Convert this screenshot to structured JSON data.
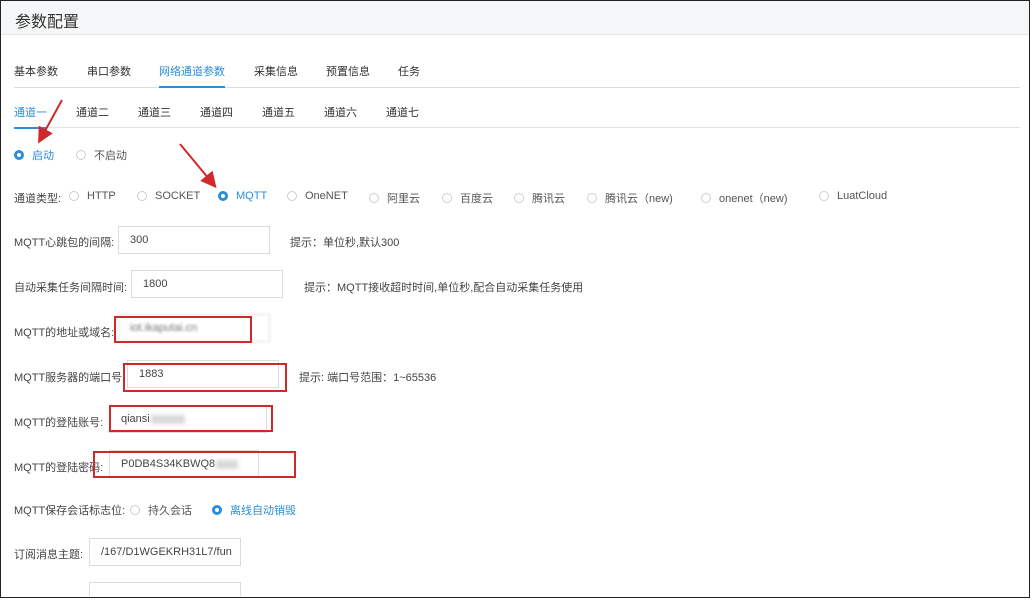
{
  "page": {
    "title": "参数配置"
  },
  "main_tabs": [
    {
      "label": "基本参数",
      "active": false
    },
    {
      "label": "串口参数",
      "active": false
    },
    {
      "label": "网络通道参数",
      "active": true
    },
    {
      "label": "采集信息",
      "active": false
    },
    {
      "label": "预置信息",
      "active": false
    },
    {
      "label": "任务",
      "active": false
    }
  ],
  "channel_tabs": [
    {
      "label": "通道一",
      "active": true
    },
    {
      "label": "通道二",
      "active": false
    },
    {
      "label": "通道三",
      "active": false
    },
    {
      "label": "通道四",
      "active": false
    },
    {
      "label": "通道五",
      "active": false
    },
    {
      "label": "通道六",
      "active": false
    },
    {
      "label": "通道七",
      "active": false
    }
  ],
  "enable": {
    "options": [
      {
        "label": "启动",
        "checked": true
      },
      {
        "label": "不启动",
        "checked": false
      }
    ]
  },
  "channel_type": {
    "label": "通道类型:",
    "options": [
      {
        "label": "HTTP",
        "checked": false
      },
      {
        "label": "SOCKET",
        "checked": false
      },
      {
        "label": "MQTT",
        "checked": true
      },
      {
        "label": "OneNET",
        "checked": false
      },
      {
        "label": "阿里云",
        "checked": false
      },
      {
        "label": "百度云",
        "checked": false
      },
      {
        "label": "腾讯云",
        "checked": false
      },
      {
        "label": "腾讯云（new)",
        "checked": false
      },
      {
        "label": "onenet（new)",
        "checked": false
      },
      {
        "label": "LuatCloud",
        "checked": false
      }
    ]
  },
  "fields": {
    "heartbeat": {
      "label": "MQTT心跳包的间隔:",
      "value": "300",
      "hint": "提示：单位秒,默认300"
    },
    "auto_collect": {
      "label": "自动采集任务间隔时间:",
      "value": "1800",
      "hint": "提示：MQTT接收超时时间,单位秒,配合自动采集任务使用"
    },
    "address": {
      "label": "MQTT的地址或域名:",
      "value": "iot.ikaputai.cn"
    },
    "port": {
      "label": "MQTT服务器的端口号:",
      "value": "1883",
      "hint": "提示: 端口号范围：1~65536"
    },
    "account": {
      "label": "MQTT的登陆账号:",
      "value": "qiansi"
    },
    "password": {
      "label": "MQTT的登陆密码:",
      "value": "P0DB4S34KBWQ8"
    },
    "session": {
      "label": "MQTT保存会话标志位:",
      "options": [
        {
          "label": "持久会话",
          "checked": false
        },
        {
          "label": "离线自动销毁",
          "checked": true
        }
      ]
    },
    "subscribe": {
      "label": "订阅消息主题:",
      "value": "/167/D1WGEKRH31L7/fun"
    }
  },
  "colors": {
    "accent": "#2c8ed8",
    "annotation": "#cf2a2a"
  }
}
